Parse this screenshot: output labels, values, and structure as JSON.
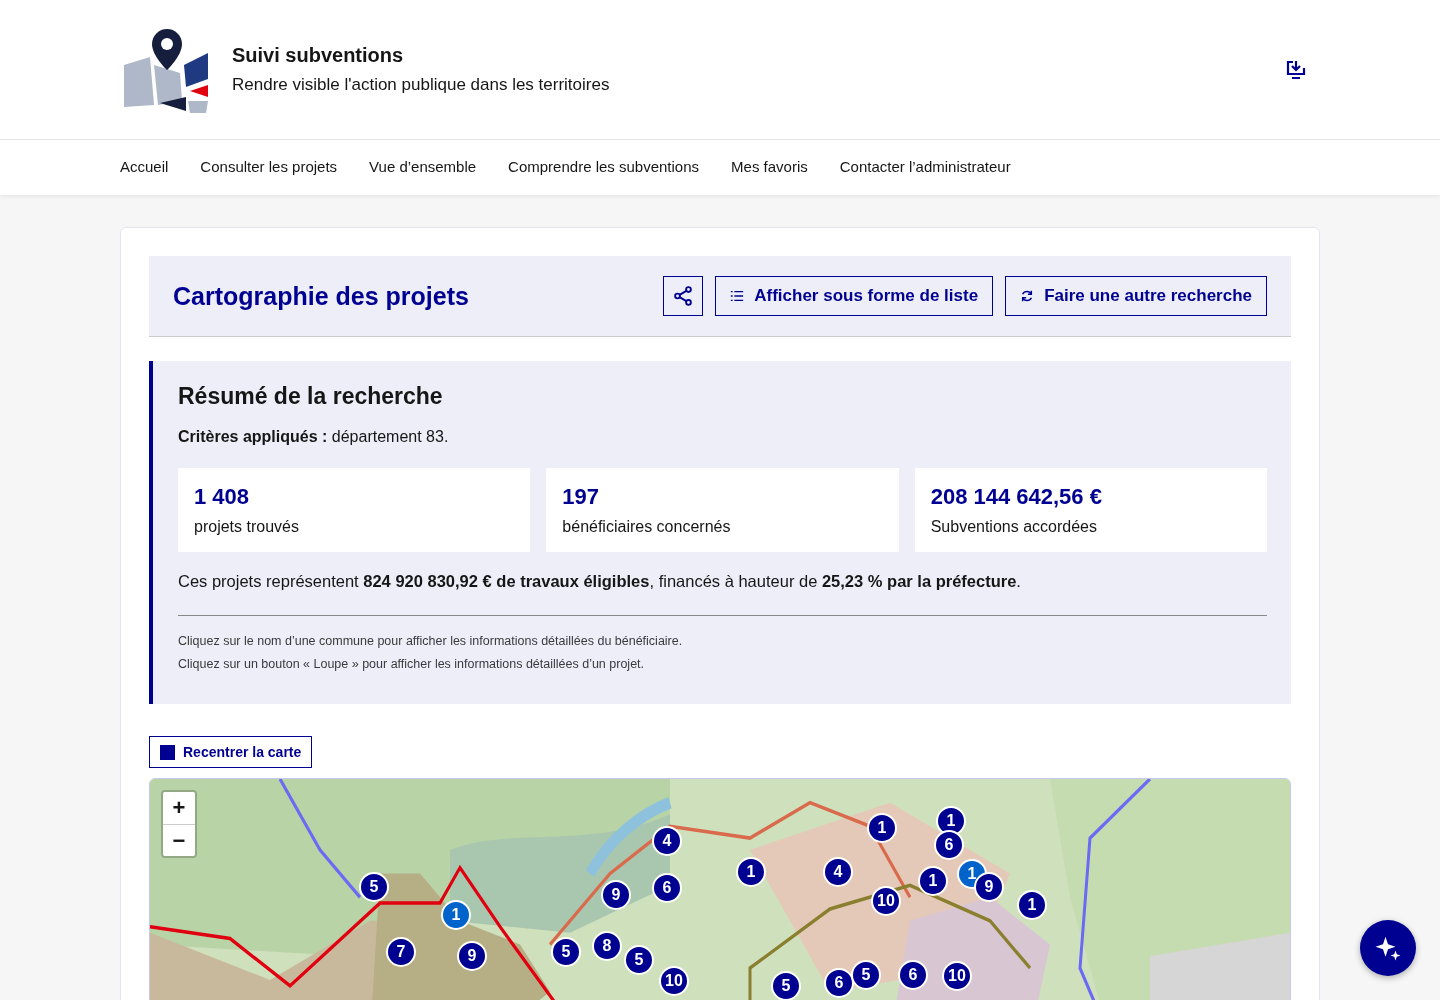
{
  "header": {
    "title": "Suivi subventions",
    "tagline": "Rendre visible l'action publique dans les territoires"
  },
  "nav": [
    {
      "label": "Accueil",
      "selected": false
    },
    {
      "label": "Consulter les projets",
      "selected": false
    },
    {
      "label": "Vue d’ensemble",
      "selected": false
    },
    {
      "label": "Comprendre les subventions",
      "selected": false
    },
    {
      "label": "Mes favoris",
      "selected": false
    },
    {
      "label": "Contacter l’administrateur",
      "selected": false
    }
  ],
  "page": {
    "title": "Cartographie des projets",
    "buttons": [
      {
        "kind": "share"
      },
      {
        "kind": "list",
        "label": "Afficher sous forme de liste"
      },
      {
        "kind": "refresh",
        "label": "Faire une autre recherche"
      }
    ]
  },
  "summary": {
    "title": "Résumé de la recherche",
    "criteria": "**Critères appliqués :** département 83.",
    "stats": [
      {
        "value": "1 408",
        "label": "projets trouvés"
      },
      {
        "value": "197",
        "label": "bénéficiaires concernés"
      },
      {
        "value": "208 144 642,56 €",
        "label": "Subventions accordées"
      }
    ],
    "sentence": "Ces projets représentent **824 920 830,92 € de travaux éligibles**, financés à hauteur de **25,23 % par la préfecture**.",
    "notes": [
      "Cliquez sur le nom d’une commune pour afficher les informations détaillées du bénéficiaire.",
      "Cliquez sur un bouton « Loupe » pour afficher les informations détaillées d’un projet."
    ]
  },
  "map": {
    "recenter": "Recentrer la carte",
    "zoom_in": "+",
    "zoom_out": "−",
    "markers": [
      {
        "count": "5",
        "color": "#000091"
      },
      {
        "count": "1",
        "color": "#0063cb"
      },
      {
        "count": "7",
        "color": "#000091"
      },
      {
        "count": "9",
        "color": "#000091"
      },
      {
        "count": "4",
        "color": "#000091"
      },
      {
        "count": "9",
        "color": "#000091"
      },
      {
        "count": "6",
        "color": "#000091"
      },
      {
        "count": "5",
        "color": "#000091"
      },
      {
        "count": "8",
        "color": "#000091"
      },
      {
        "count": "5",
        "color": "#000091"
      },
      {
        "count": "10",
        "color": "#000091"
      },
      {
        "count": "1",
        "color": "#000091"
      },
      {
        "count": "4",
        "color": "#000091"
      },
      {
        "count": "1",
        "color": "#000091"
      },
      {
        "count": "1",
        "color": "#000091"
      },
      {
        "count": "6",
        "color": "#000091"
      },
      {
        "count": "1",
        "color": "#000091"
      },
      {
        "count": "1",
        "color": "#0063cb"
      },
      {
        "count": "9",
        "color": "#000091"
      },
      {
        "count": "1",
        "color": "#000091"
      },
      {
        "count": "10",
        "color": "#000091"
      },
      {
        "count": "5",
        "color": "#000091"
      },
      {
        "count": "6",
        "color": "#000091"
      },
      {
        "count": "5",
        "color": "#000091"
      },
      {
        "count": "6",
        "color": "#000091"
      },
      {
        "count": "10",
        "color": "#000091"
      }
    ]
  }
}
